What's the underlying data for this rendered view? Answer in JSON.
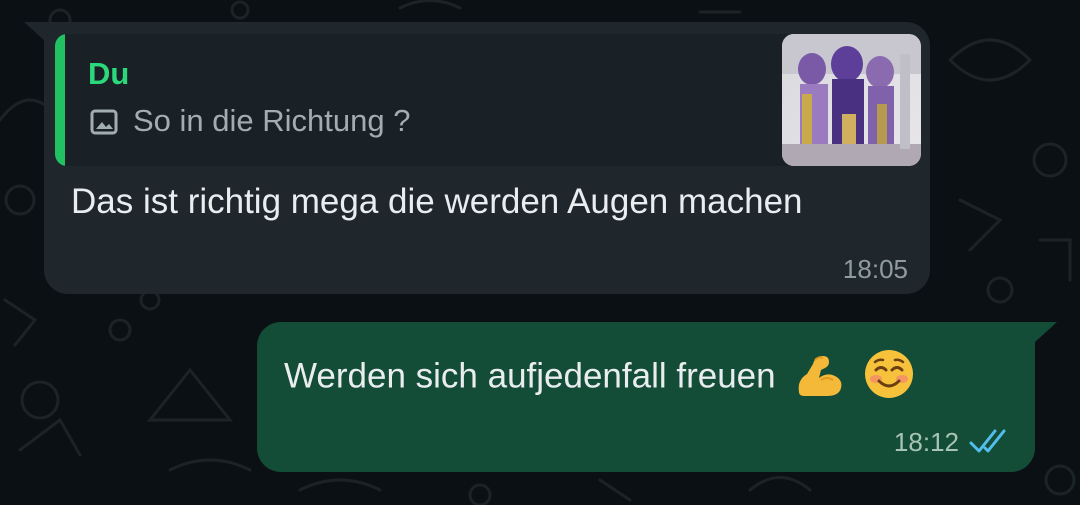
{
  "colors": {
    "chat_background": "#0b1014",
    "incoming_bubble": "#1f272d",
    "outgoing_bubble": "#144d37",
    "quote_accent": "#21c063",
    "read_ticks": "#53bdeb"
  },
  "incoming_message": {
    "quote": {
      "author": "Du",
      "media_icon": "image-icon",
      "text": "So in die Richtung ?"
    },
    "text": "Das ist richtig mega die werden Augen machen",
    "time": "18:05"
  },
  "outgoing_message": {
    "text": "Werden sich aufjedenfall freuen",
    "emojis": [
      "flexed-biceps-emoji",
      "smiling-face-emoji"
    ],
    "time": "18:12",
    "status": "read",
    "status_icon": "double-check-icon"
  }
}
